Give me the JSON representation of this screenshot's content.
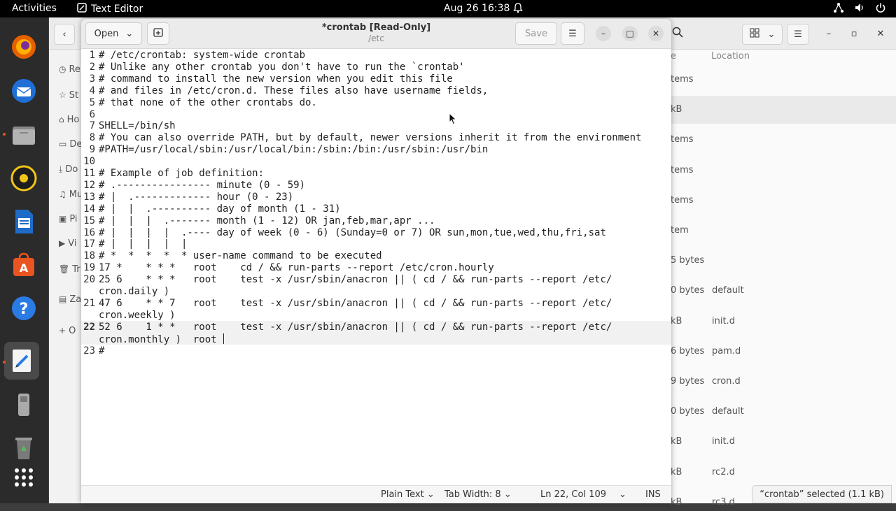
{
  "topbar": {
    "activities": "Activities",
    "app_name": "Text Editor",
    "clock": "Aug 26  16:38"
  },
  "file_manager": {
    "location_header": "Location",
    "size_header_fragment": "e",
    "sidebar_items": [
      {
        "label": "Re",
        "icon": "clock-icon"
      },
      {
        "label": "St",
        "icon": "star-icon"
      },
      {
        "label": "Ho",
        "icon": "home-icon"
      },
      {
        "label": "De",
        "icon": "desktop-icon"
      },
      {
        "label": "Do",
        "icon": "download-icon"
      },
      {
        "label": "Mu",
        "icon": "music-icon"
      },
      {
        "label": "Pi",
        "icon": "picture-icon"
      },
      {
        "label": "Vi",
        "icon": "video-icon"
      },
      {
        "label": "Tr",
        "icon": "trash-icon"
      },
      {
        "label": "Za",
        "icon": "drive-icon"
      },
      {
        "label": "O",
        "icon": "plus-icon"
      }
    ],
    "rows": [
      {
        "size": "tems",
        "location": ""
      },
      {
        "size": "kB",
        "location": ""
      },
      {
        "size": "tems",
        "location": ""
      },
      {
        "size": "tems",
        "location": ""
      },
      {
        "size": "tems",
        "location": ""
      },
      {
        "size": "tem",
        "location": ""
      },
      {
        "size": "5 bytes",
        "location": ""
      },
      {
        "size": "0 bytes",
        "location": "default"
      },
      {
        "size": "kB",
        "location": "init.d"
      },
      {
        "size": "6 bytes",
        "location": "pam.d"
      },
      {
        "size": "9 bytes",
        "location": "cron.d"
      },
      {
        "size": "0 bytes",
        "location": "default"
      },
      {
        "size": "kB",
        "location": "init.d"
      },
      {
        "size": "kB",
        "location": "rc2.d"
      },
      {
        "size": "kB",
        "location": "rc3.d"
      }
    ],
    "status": "“crontab” selected  (1.1 kB)"
  },
  "editor": {
    "open_label": "Open",
    "save_label": "Save",
    "title": "*crontab [Read-Only]",
    "subtitle": "/etc",
    "lines": [
      {
        "n": "1",
        "text": "# /etc/crontab: system-wide crontab"
      },
      {
        "n": "2",
        "text": "# Unlike any other crontab you don't have to run the `crontab'"
      },
      {
        "n": "3",
        "text": "# command to install the new version when you edit this file"
      },
      {
        "n": "4",
        "text": "# and files in /etc/cron.d. These files also have username fields,"
      },
      {
        "n": "5",
        "text": "# that none of the other crontabs do."
      },
      {
        "n": "6",
        "text": ""
      },
      {
        "n": "7",
        "text": "SHELL=/bin/sh"
      },
      {
        "n": "8",
        "text": "# You can also override PATH, but by default, newer versions inherit it from the environment"
      },
      {
        "n": "9",
        "text": "#PATH=/usr/local/sbin:/usr/local/bin:/sbin:/bin:/usr/sbin:/usr/bin"
      },
      {
        "n": "10",
        "text": ""
      },
      {
        "n": "11",
        "text": "# Example of job definition:"
      },
      {
        "n": "12",
        "text": "# .---------------- minute (0 - 59)"
      },
      {
        "n": "13",
        "text": "# |  .------------- hour (0 - 23)"
      },
      {
        "n": "14",
        "text": "# |  |  .---------- day of month (1 - 31)"
      },
      {
        "n": "15",
        "text": "# |  |  |  .------- month (1 - 12) OR jan,feb,mar,apr ..."
      },
      {
        "n": "16",
        "text": "# |  |  |  |  .---- day of week (0 - 6) (Sunday=0 or 7) OR sun,mon,tue,wed,thu,fri,sat"
      },
      {
        "n": "17",
        "text": "# |  |  |  |  |"
      },
      {
        "n": "18",
        "text": "# *  *  *  *  * user-name command to be executed"
      },
      {
        "n": "19",
        "text": "17 *    * * *   root    cd / && run-parts --report /etc/cron.hourly"
      },
      {
        "n": "20",
        "text": "25 6    * * *   root    test -x /usr/sbin/anacron || ( cd / && run-parts --report /etc/",
        "cont": "cron.daily )"
      },
      {
        "n": "21",
        "text": "47 6    * * 7   root    test -x /usr/sbin/anacron || ( cd / && run-parts --report /etc/",
        "cont": "cron.weekly )"
      },
      {
        "n": "22",
        "text": "52 6    1 * *   root    test -x /usr/sbin/anacron || ( cd / && run-parts --report /etc/",
        "cont": "cron.monthly )  root "
      },
      {
        "n": "23",
        "text": "#"
      }
    ],
    "current_line": "22",
    "status": {
      "language": "Plain Text",
      "tab_width": "Tab Width: 8",
      "position": "Ln 22, Col 109",
      "mode": "INS"
    }
  }
}
